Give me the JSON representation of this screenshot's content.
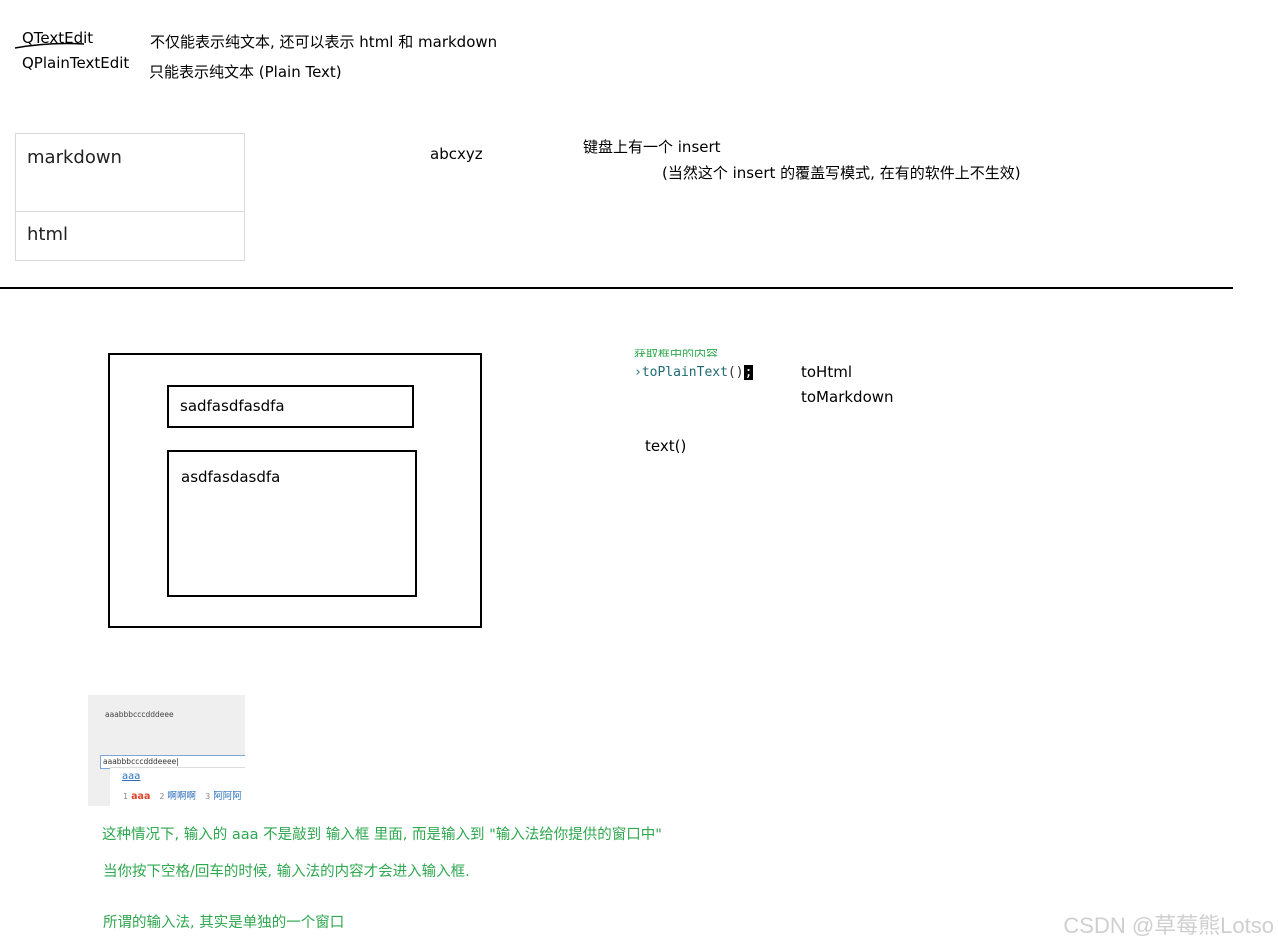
{
  "top": {
    "qtextedit_label": "QTextEdit",
    "qtextedit_desc": "不仅能表示纯文本, 还可以表示 html 和 markdown",
    "qplaintextedit_label": "QPlainTextEdit",
    "qplaintextedit_desc": "只能表示纯文本 (Plain Text)"
  },
  "format_table": {
    "rows": [
      "markdown",
      "html"
    ]
  },
  "sample_text": "abcxyz",
  "insert_note": {
    "line1": "键盘上有一个 insert",
    "line2": "(当然这个 insert 的覆盖写模式, 在有的软件上不生效)"
  },
  "sketch": {
    "line_edit_text": "sadfasdfasdfa",
    "text_edit_text": "asdfasdasdfa"
  },
  "code": {
    "cropped_comment": "获取框中的内容",
    "call": "toPlainText",
    "parens": "()",
    "semicolon": ";"
  },
  "methods": {
    "to_html": "toHtml",
    "to_markdown": "toMarkdown",
    "text": "text()"
  },
  "ime": {
    "top_text": "aaabbbcccdddeee",
    "input_text": "aaabbbcccdddeeee|",
    "composing": "aaa",
    "candidates": [
      {
        "num": "1",
        "text": "aaa"
      },
      {
        "num": "2",
        "text": "啊啊啊"
      },
      {
        "num": "3",
        "text": "阿阿阿"
      }
    ]
  },
  "notes": {
    "line1": "这种情况下, 输入的 aaa 不是敲到 输入框 里面, 而是输入到 \"输入法给你提供的窗口中\"",
    "line2": "当你按下空格/回车的时候, 输入法的内容才会进入输入框.",
    "line3": "所谓的输入法, 其实是单独的一个窗口"
  },
  "watermark": "CSDN @草莓熊Lotso",
  "colors": {
    "note_green": "#2fa84f",
    "code_teal": "#1e6a73",
    "candidate_red": "#e0452a",
    "candidate_blue": "#2a6ebb"
  }
}
